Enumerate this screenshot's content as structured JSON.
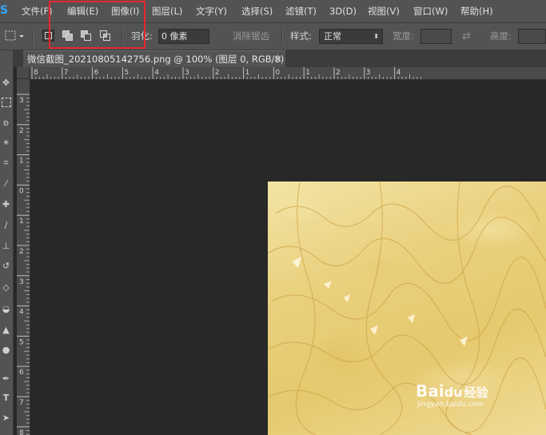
{
  "app": {
    "logo": "S"
  },
  "menu": {
    "items": [
      "文件(F)",
      "编辑(E)",
      "图像(I)",
      "图层(L)",
      "文字(Y)",
      "选择(S)",
      "滤镜(T)",
      "3D(D)",
      "视图(V)",
      "窗口(W)",
      "帮助(H)"
    ],
    "highlighted": [
      "编辑(E)",
      "图像(I)"
    ],
    "highlight_color": "#e8262d"
  },
  "options": {
    "feather_label": "羽化:",
    "feather_value": "0 像素",
    "antialias_label": "消除锯齿",
    "style_label": "样式:",
    "style_value": "正常",
    "width_label": "宽度:",
    "height_label": "高度:"
  },
  "document": {
    "tab_title": "微信截图_20210805142756.png @ 100% (图层 0, RGB/8)",
    "close_glyph": "×"
  },
  "rulers": {
    "horizontal": [
      "8",
      "7",
      "6",
      "5",
      "4",
      "3",
      "2",
      "1",
      "0",
      "1",
      "2",
      "3",
      "4"
    ],
    "vertical": [
      "3",
      "2",
      "1",
      "0",
      "1",
      "2",
      "3",
      "4",
      "5",
      "6",
      "7",
      "8"
    ]
  },
  "watermark": {
    "brand": "Bai",
    "paw": "du",
    "cn": "经验",
    "url": "jingyan.baidu.com"
  },
  "colors": {
    "accent": "#33aaff",
    "ui_bg": "#535353",
    "canvas_bg": "#282828"
  }
}
